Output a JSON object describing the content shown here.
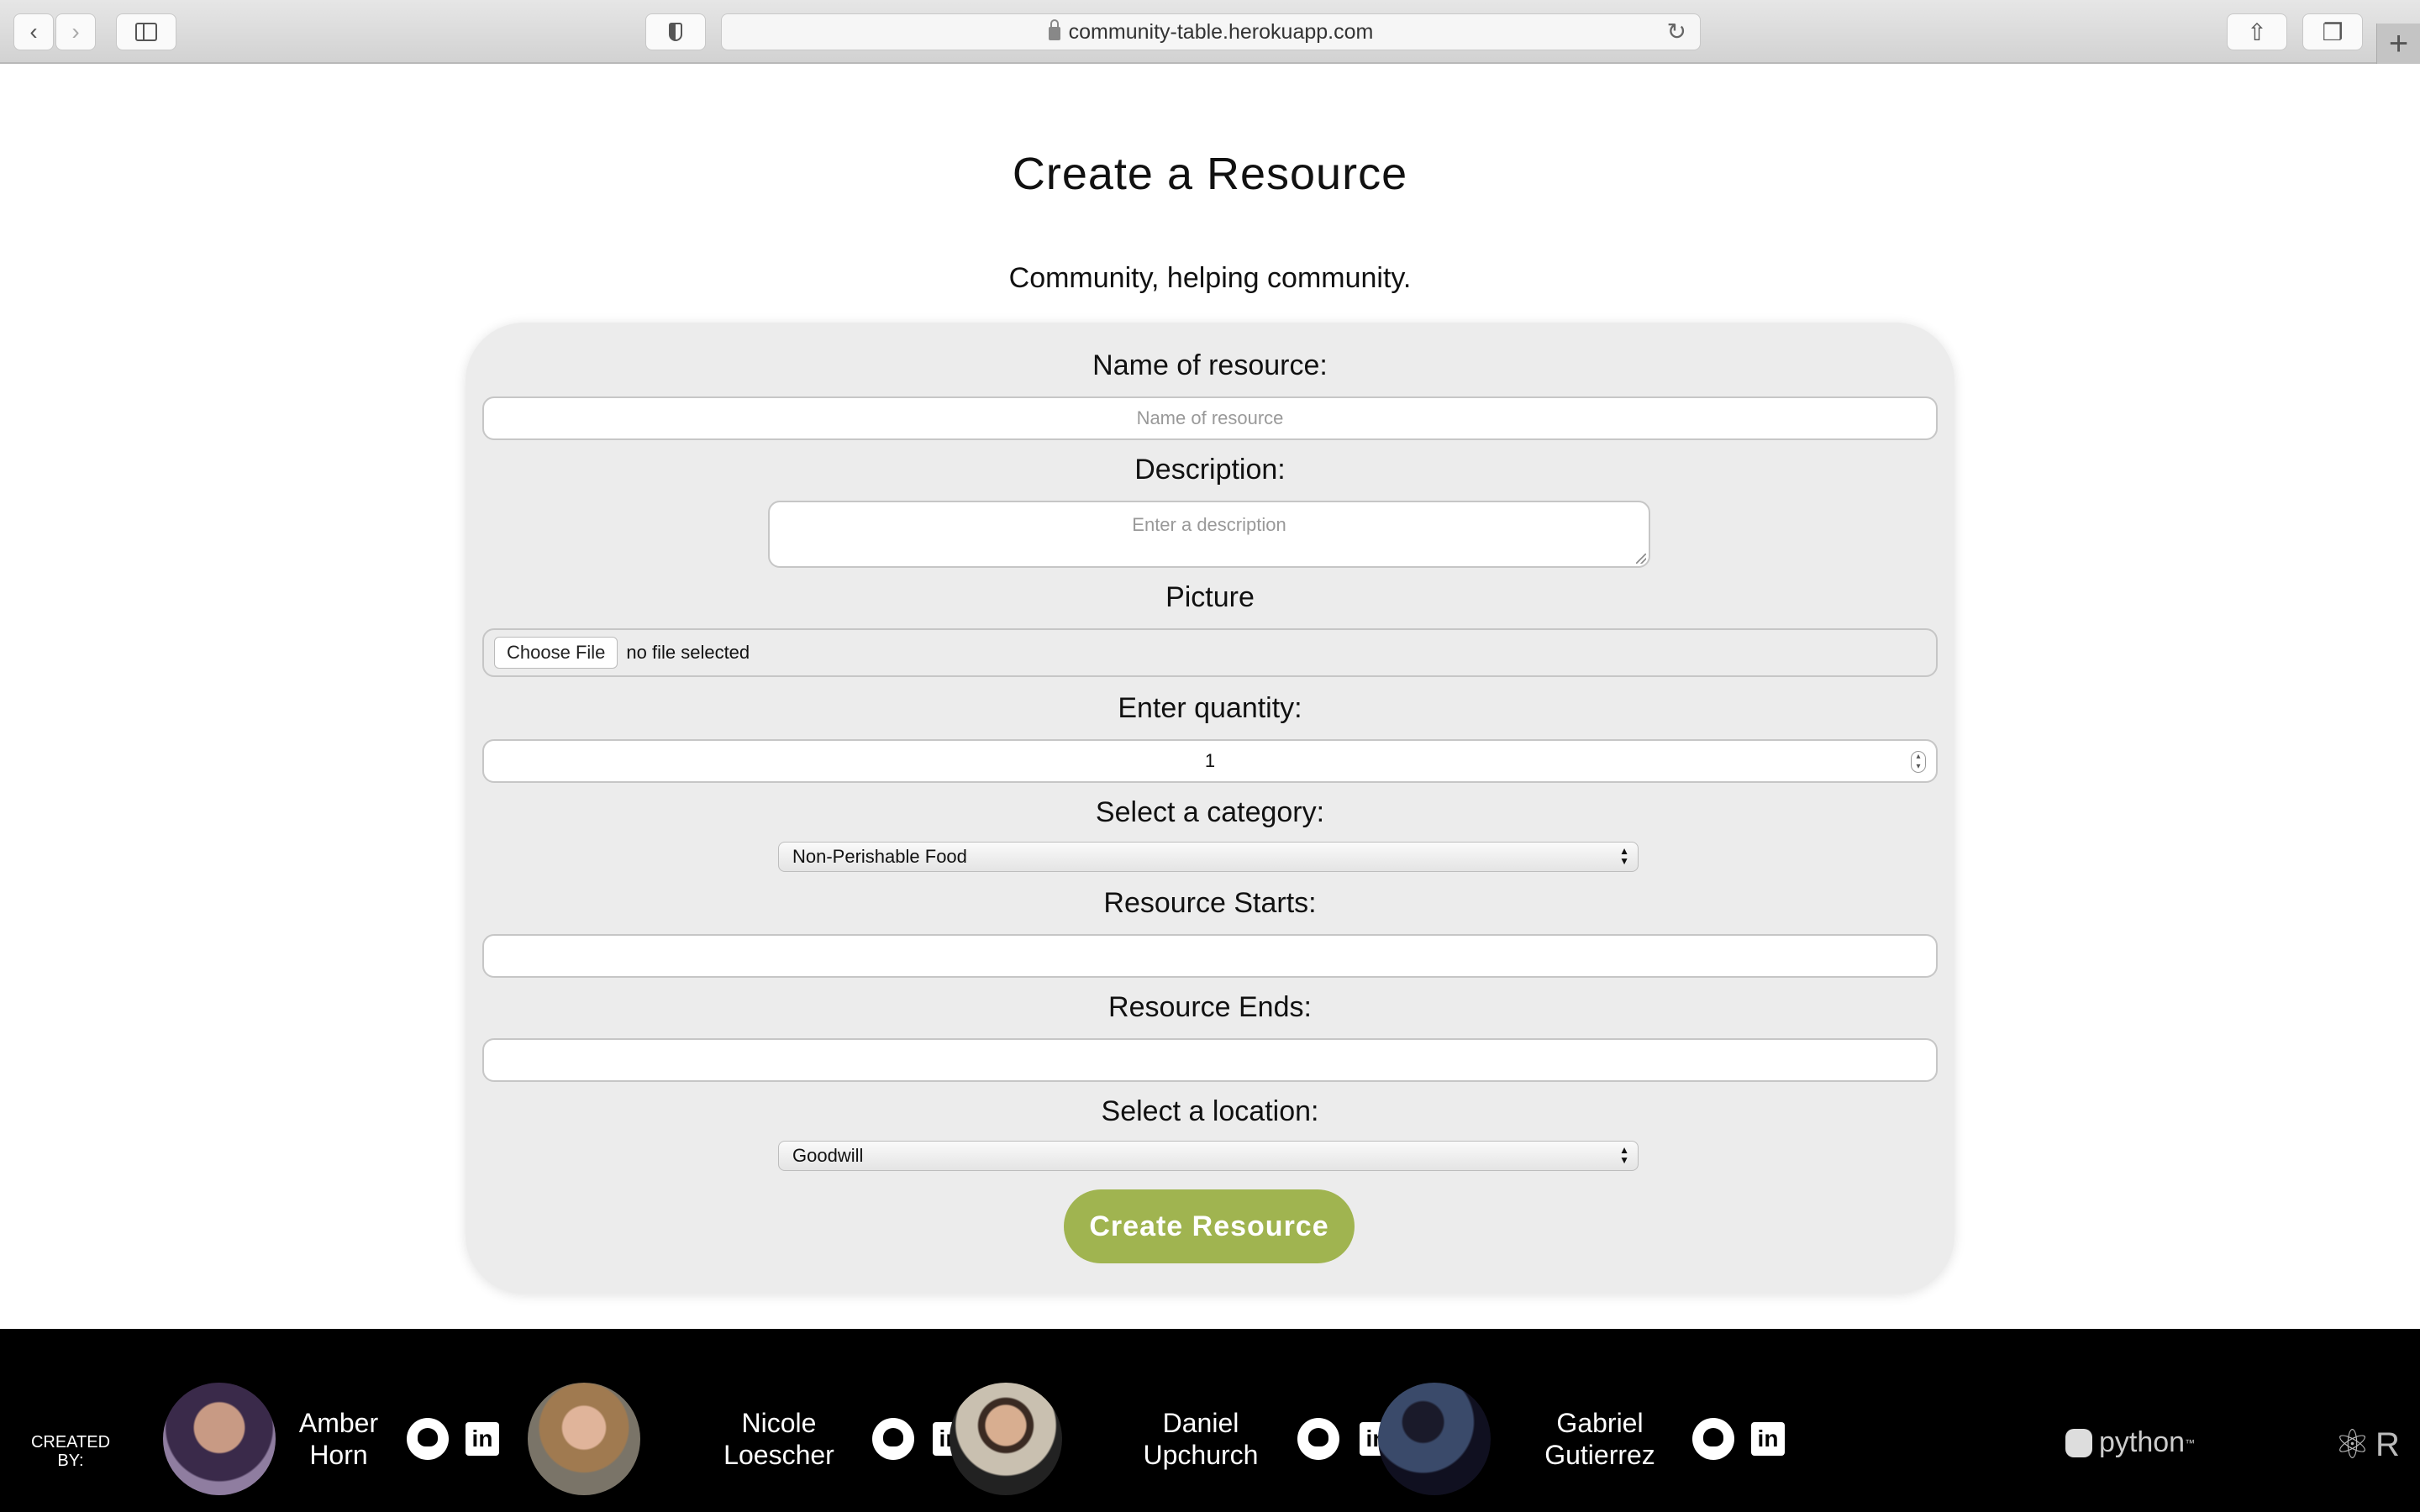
{
  "browser": {
    "url": "community-table.herokuapp.com",
    "icons": {
      "back": "chevron-left-icon",
      "forward": "chevron-right-icon",
      "sidebar": "sidebar-icon",
      "privacy": "shield-icon",
      "reload": "reload-icon",
      "share": "share-icon",
      "tabs": "tabs-icon",
      "new_tab": "plus-icon"
    }
  },
  "page": {
    "title": "Create a Resource",
    "tagline": "Community, helping community."
  },
  "form": {
    "name_label": "Name of resource:",
    "name_placeholder": "Name of resource",
    "description_label": "Description:",
    "description_placeholder": "Enter a description",
    "picture_label": "Picture",
    "choose_file_label": "Choose File",
    "file_status": "no file selected",
    "quantity_label": "Enter quantity:",
    "quantity_value": "1",
    "category_label": "Select a category:",
    "category_selected": "Non-Perishable Food",
    "starts_label": "Resource Starts:",
    "starts_value": "",
    "ends_label": "Resource Ends:",
    "ends_value": "",
    "location_label": "Select a location:",
    "location_selected": "Goodwill",
    "submit_label": "Create Resource",
    "accent_color": "#a0b450"
  },
  "footer": {
    "created_by": "CREATED BY:",
    "members": [
      {
        "first": "Amber",
        "last": "Horn"
      },
      {
        "first": "Nicole",
        "last": "Loescher"
      },
      {
        "first": "Daniel",
        "last": "Upchurch"
      },
      {
        "first": "Gabriel",
        "last": "Gutierrez"
      }
    ],
    "tech": {
      "python": "python",
      "python_tm": "™",
      "react_partial": "R"
    }
  }
}
